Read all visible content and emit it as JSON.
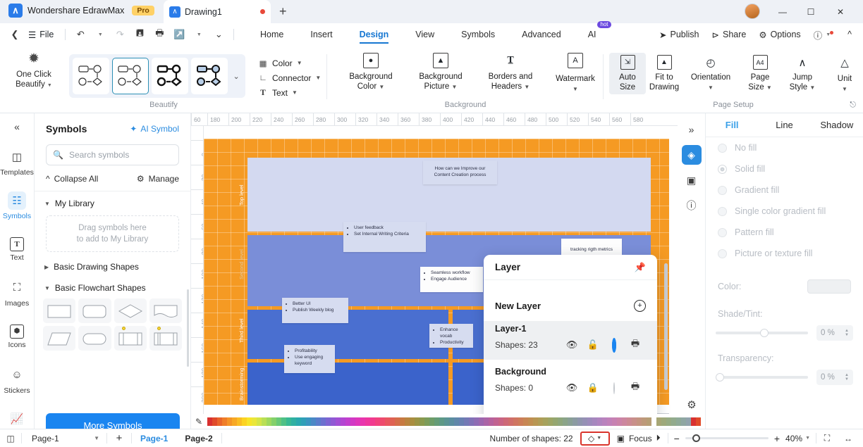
{
  "titlebar": {
    "brand": "Wondershare EdrawMax",
    "pro_badge": "Pro",
    "document_tab": "Drawing1",
    "new_tab_icon": "plus-icon",
    "minimize": "—",
    "maximize": "☐",
    "close": "✕"
  },
  "menubar": {
    "back_icon": "chevron-left-icon",
    "file": "File",
    "undo_icon": "undo-icon",
    "redo_icon": "redo-icon",
    "save_icon": "save-icon",
    "print_icon": "print-icon",
    "export_icon": "export-icon",
    "more_icon": "chevron-down-icon",
    "tabs": [
      {
        "label": "Home",
        "active": false
      },
      {
        "label": "Insert",
        "active": false
      },
      {
        "label": "Design",
        "active": true
      },
      {
        "label": "View",
        "active": false
      },
      {
        "label": "Symbols",
        "active": false
      },
      {
        "label": "Advanced",
        "active": false
      },
      {
        "label": "AI",
        "active": false,
        "badge": "hot"
      }
    ],
    "publish": "Publish",
    "share": "Share",
    "options": "Options",
    "help_icon": "help-icon",
    "collapse_icon": "chevron-up-icon"
  },
  "ribbon": {
    "beautify": {
      "group_label": "Beautify",
      "one_click": "One Click\nBeautify",
      "one_click_line1": "One Click",
      "one_click_line2": "Beautify",
      "styles": [
        "style-outline-light",
        "style-outline-selected",
        "style-bold-outline",
        "style-filled-blue"
      ],
      "selected_style_index": 1,
      "more_icon": "more-styles-icon",
      "color": "Color",
      "connector": "Connector",
      "text": "Text"
    },
    "background": {
      "group_label": "Background",
      "items": [
        {
          "label_line1": "Background",
          "label_line2": "Color",
          "icon": "background-color-icon"
        },
        {
          "label_line1": "Background",
          "label_line2": "Picture",
          "icon": "background-picture-icon"
        },
        {
          "label_line1": "Borders and",
          "label_line2": "Headers",
          "icon": "borders-headers-icon"
        },
        {
          "label_line1": "Watermark",
          "label_line2": "",
          "icon": "watermark-icon"
        }
      ]
    },
    "page_setup": {
      "group_label": "Page Setup",
      "items": [
        {
          "label_line1": "Auto",
          "label_line2": "Size",
          "icon": "auto-size-icon",
          "selected": true
        },
        {
          "label_line1": "Fit to",
          "label_line2": "Drawing",
          "icon": "fit-to-drawing-icon",
          "selected": false
        },
        {
          "label_line1": "Orientation",
          "label_line2": "",
          "icon": "orientation-icon",
          "selected": false
        },
        {
          "label_line1": "Page",
          "label_line2": "Size",
          "icon": "page-size-icon",
          "selected": false
        },
        {
          "label_line1": "Jump",
          "label_line2": "Style",
          "icon": "jump-style-icon",
          "selected": false
        },
        {
          "label_line1": "Unit",
          "label_line2": "",
          "icon": "unit-icon",
          "selected": false
        }
      ],
      "dialog_launcher": "dialog-launcher-icon"
    }
  },
  "left_rail": {
    "collapse_icon": "double-chevron-left-icon",
    "items": [
      {
        "label": "Templates",
        "icon": "templates-icon",
        "active": false
      },
      {
        "label": "Symbols",
        "icon": "symbols-icon",
        "active": true
      },
      {
        "label": "Text",
        "icon": "text-icon",
        "active": false
      },
      {
        "label": "Images",
        "icon": "images-icon",
        "active": false
      },
      {
        "label": "Icons",
        "icon": "icons-icon",
        "active": false
      },
      {
        "label": "Stickers",
        "icon": "stickers-icon",
        "active": false
      },
      {
        "label": "Charts",
        "icon": "charts-icon",
        "active": false
      }
    ]
  },
  "symbols_panel": {
    "title": "Symbols",
    "ai_symbol": "AI Symbol",
    "ai_symbol_icon": "magic-wand-icon",
    "search_placeholder": "Search symbols",
    "search_value": "",
    "search_icon": "search-icon",
    "collapse_all": "Collapse All",
    "collapse_all_icon": "chevron-up-double-icon",
    "manage": "Manage",
    "manage_icon": "gear-icon",
    "sections": [
      {
        "label": "My Library",
        "expanded": true
      },
      {
        "label": "Basic Drawing Shapes",
        "expanded": false
      },
      {
        "label": "Basic Flowchart Shapes",
        "expanded": true
      }
    ],
    "drop_hint_line1": "Drag symbols here",
    "drop_hint_line2": "to add to My Library",
    "flowchart_shapes": [
      "rectangle",
      "rounded-rectangle",
      "diamond",
      "document",
      "parallelogram",
      "terminator",
      "predefined-process",
      "internal-storage"
    ],
    "more_symbols": "More Symbols"
  },
  "canvas": {
    "h_ruler_ticks": [
      "60",
      "180",
      "200",
      "220",
      "240",
      "260",
      "280",
      "300",
      "320",
      "340",
      "360",
      "380",
      "400",
      "420",
      "440",
      "460",
      "480",
      "500",
      "520",
      "540",
      "560",
      "580"
    ],
    "v_ruler_ticks": [
      "0",
      "20",
      "40",
      "60",
      "80",
      "100",
      "120",
      "140",
      "160",
      "180",
      "200",
      "220",
      "0"
    ],
    "background_color": "#F59A23",
    "swimlane_labels": [
      "Top level",
      "Second level",
      "Third level",
      "Brainstorming"
    ],
    "notes": [
      {
        "id": "n1",
        "text": "How can we Improve our Content Creation process"
      },
      {
        "id": "n2",
        "items": [
          "User feedback",
          "Set Internal Writing Criteria"
        ]
      },
      {
        "id": "n3",
        "text": "tracking rigth metrics"
      },
      {
        "id": "n4",
        "items": [
          "Seamless workflow",
          "Engage Audience"
        ]
      },
      {
        "id": "n5",
        "items": [
          "Better UI",
          "Publish Weekly blog"
        ]
      },
      {
        "id": "n6",
        "items": [
          "Enhance vocab",
          "Productivity"
        ]
      },
      {
        "id": "n7",
        "items": [
          "Profitability",
          "Use engaging keyword"
        ]
      }
    ]
  },
  "layer_popup": {
    "title": "Layer",
    "pin_icon": "pin-icon",
    "new_layer": "New Layer",
    "add_icon": "plus-circle-icon",
    "rows": [
      {
        "name": "Layer-1",
        "shapes": "Shapes: 23",
        "selected": true,
        "active_radio": true,
        "visible_icon": "eye-icon",
        "lock_icon": "unlock-icon",
        "print_icon": "print-icon"
      },
      {
        "name": "Background",
        "shapes": "Shapes: 0",
        "selected": false,
        "active_radio": false,
        "visible_icon": "eye-icon",
        "lock_icon": "lock-icon",
        "print_icon": "print-icon"
      }
    ]
  },
  "mini_rail": {
    "collapse_icon": "double-chevron-right-icon",
    "items": [
      {
        "icon": "fill-bucket-icon",
        "active": true
      },
      {
        "icon": "presentation-icon",
        "active": false
      },
      {
        "icon": "help-circle-icon",
        "active": false
      }
    ],
    "gear_icon": "settings-gear-icon"
  },
  "right_panel": {
    "tabs": [
      {
        "label": "Fill",
        "active": true
      },
      {
        "label": "Line",
        "active": false
      },
      {
        "label": "Shadow",
        "active": false
      }
    ],
    "fill_options": [
      {
        "label": "No fill",
        "selected": false
      },
      {
        "label": "Solid fill",
        "selected": true
      },
      {
        "label": "Gradient fill",
        "selected": false
      },
      {
        "label": "Single color gradient fill",
        "selected": false
      },
      {
        "label": "Pattern fill",
        "selected": false
      },
      {
        "label": "Picture or texture fill",
        "selected": false
      }
    ],
    "color_label": "Color:",
    "shade_label": "Shade/Tint:",
    "shade_value": "0 %",
    "transparency_label": "Transparency:",
    "transparency_value": "0 %"
  },
  "swatches": {
    "eyedropper_icon": "color-picker-icon",
    "colors": [
      "#d83030",
      "#e04a2a",
      "#e8642a",
      "#ef7d28",
      "#f49427",
      "#f7a825",
      "#fabd24",
      "#fcd322",
      "#f7e42b",
      "#eae63a",
      "#d4e449",
      "#b9df55",
      "#9ed85f",
      "#83d06b",
      "#68c878",
      "#4ec086",
      "#38b894",
      "#2fb0a2",
      "#2aa8ae",
      "#2f9fb8",
      "#3b94c0",
      "#4a88c6",
      "#5a7ccb",
      "#6b70cf",
      "#7d64d2",
      "#8f59d4",
      "#a14fd4",
      "#b246d2",
      "#c23fcd",
      "#d139c5",
      "#de36bb",
      "#e835ae",
      "#ee369f",
      "#f13a8f",
      "#f1417e",
      "#ee4a6e",
      "#e85560",
      "#df6153",
      "#d46d49",
      "#c77942",
      "#b9843f",
      "#aa8d40",
      "#9a9445",
      "#8a994e",
      "#7b9c5a",
      "#6e9d68",
      "#649c77",
      "#5d9986",
      "#5a9494",
      "#5b8ea0",
      "#6087aa",
      "#6880b1",
      "#7379b5",
      "#8072b6",
      "#8e6cb4",
      "#9c67af",
      "#aa64a7",
      "#b6629d",
      "#c06291",
      "#c86484",
      "#cd6877",
      "#cf6e6b",
      "#cf7561",
      "#cc7d59",
      "#c78654",
      "#c08e52",
      "#b89653",
      "#af9d57",
      "#a6a25d",
      "#9da566",
      "#94a670",
      "#8ea67c",
      "#8aa489",
      "#89a096",
      "#8b9ba2",
      "#8f95ad",
      "#9590b5",
      "#9d8bbb",
      "#a687be",
      "#b084bf",
      "#b982bd",
      "#c181b9",
      "#c781b2",
      "#cb83a9",
      "#cc869f",
      "#cb8a94",
      "#c88f8a",
      "#c39481",
      "#bd997a",
      "#b69e76",
      "#ae a274",
      "#a6a676",
      "#9ea97b",
      "#97ab83",
      "#92ab8d",
      "#8faa98",
      "#8fa7a3",
      "#91a3ad",
      "#d83030",
      "#e04a2a"
    ]
  },
  "statusbar": {
    "layout_icon": "page-layout-icon",
    "page_selector": "Page-1",
    "page_selector_caret": "chevron-down-icon",
    "add_page_icon": "plus-icon",
    "pages": [
      {
        "label": "Page-1",
        "active": true
      },
      {
        "label": "Page-2",
        "active": false
      }
    ],
    "shape_count": "Number of shapes: 22",
    "layer_button_icon": "layers-icon",
    "layer_button_caret": "chevron-down-icon",
    "focus": "Focus",
    "focus_play_icon": "play-circle-icon",
    "zoom_out_icon": "minus-icon",
    "zoom_in_icon": "plus-icon",
    "zoom_level": "40%",
    "zoom_caret": "chevron-down-icon",
    "fit_page_icon": "fit-page-icon",
    "fit_width_icon": "fit-width-icon"
  }
}
